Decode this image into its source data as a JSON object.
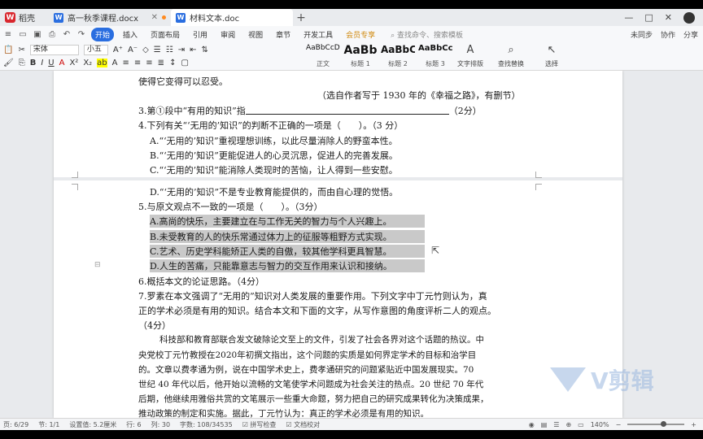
{
  "tabs": {
    "app": "稻壳",
    "doc1": "高一秋季课程.docx",
    "doc2": "材料文本.doc"
  },
  "window": {
    "minimize": "—",
    "maximize": "□",
    "close": "✕"
  },
  "menu": {
    "items": [
      "开始",
      "插入",
      "页面布局",
      "引用",
      "审阅",
      "视图",
      "章节",
      "开发工具",
      "会员专享"
    ],
    "active": "开始",
    "search": "查找命令、搜索模板",
    "right": [
      "未同步",
      "协作",
      "分享"
    ]
  },
  "ribbon": {
    "font": "宋体",
    "size": "小五",
    "styles": [
      {
        "sample": "AaBbCcDd",
        "label": "正文"
      },
      {
        "sample": "AaBb",
        "label": "标题 1"
      },
      {
        "sample": "AaBbC",
        "label": "标题 2"
      },
      {
        "sample": "AaBbCc",
        "label": "标题 3"
      }
    ],
    "tools": [
      {
        "icon": "A",
        "label": "文字排版"
      },
      {
        "icon": "⌕",
        "label": "查找替换"
      },
      {
        "icon": "↖",
        "label": "选择"
      }
    ]
  },
  "document": {
    "lines": [
      "使得它变得可以忍受。",
      "（选自作者写于 1930 年的《幸福之路》，有删节）",
      "3.第①段中“有用的知识”指",
      "（2分）",
      "4.下列有关“‘无用的’知识”的判断不正确的一项是（　　）。（3 分）",
      "A.“‘无用的’知识”重视理想训练，以此尽量消除人的野蛮本性。",
      "B.“‘无用的’知识”更能促进人的心灵沉思，促进人的完善发展。",
      "C.“‘无用的’知识”能消除人类现时的苦恼，让人得到一些安慰。",
      "D.“‘无用的’知识”不是专业教育能提供的，而由自心理的觉悟。",
      "5.与原文观点不一致的一项是（　　）。（3分）",
      "A.高尚的快乐，主要建立在与工作无关的智力与个人兴趣上。",
      "B.未受教育的人的快乐常通过体力上的征服等粗野方式实现。",
      "C.艺术、历史学科能矫正人类的自傲，较其他学科更具智慧。",
      "D.人生的苦痛，只能靠意志与智力的交互作用来认识和接纳。",
      "6.概括本文的论证思路。（4分）",
      "7.罗素在本文强调了“无用的”知识对人类发展的重要作用。下列文字中丁元竹则认为，真",
      "正的学术必须是有用的知识。结合本文和下面的文字，从写作意图的角度评析二人的观点。",
      "（4分）",
      "科技部和教育部联合发文破除论文至上的文件，引发了社会各界对这个话题的热议。中",
      "央党校丁元竹教授在2020年初撰文指出，这个问题的实质是如何界定学术的目标和治学目",
      "的。文章以费孝通为例，说在中国学术史上，费孝通研究的问题紧贴近中国发展现实。70",
      "世纪 40 年代以后，他开始以流畅的文笔使学术问题成为社会关注的热点。20 世纪 70 年代",
      "后期，他继续用雅俗共赏的文笔展示一些重大命题，努力把自己的研究成果转化为决策成果，",
      "推动政策的制定和实施。据此，丁元竹认为：真正的学术必须是有用的知识。"
    ]
  },
  "watermark": "V剪辑",
  "status": {
    "page": "页: 6/29",
    "section": "节: 1/1",
    "position": "设置值: 5.2厘米",
    "row": "行: 6",
    "col": "列: 30",
    "words": "字数: 108/34535",
    "spell": "拼写检查",
    "proof": "文档校对",
    "zoom": "140%",
    "zoom_level": 0.63
  }
}
